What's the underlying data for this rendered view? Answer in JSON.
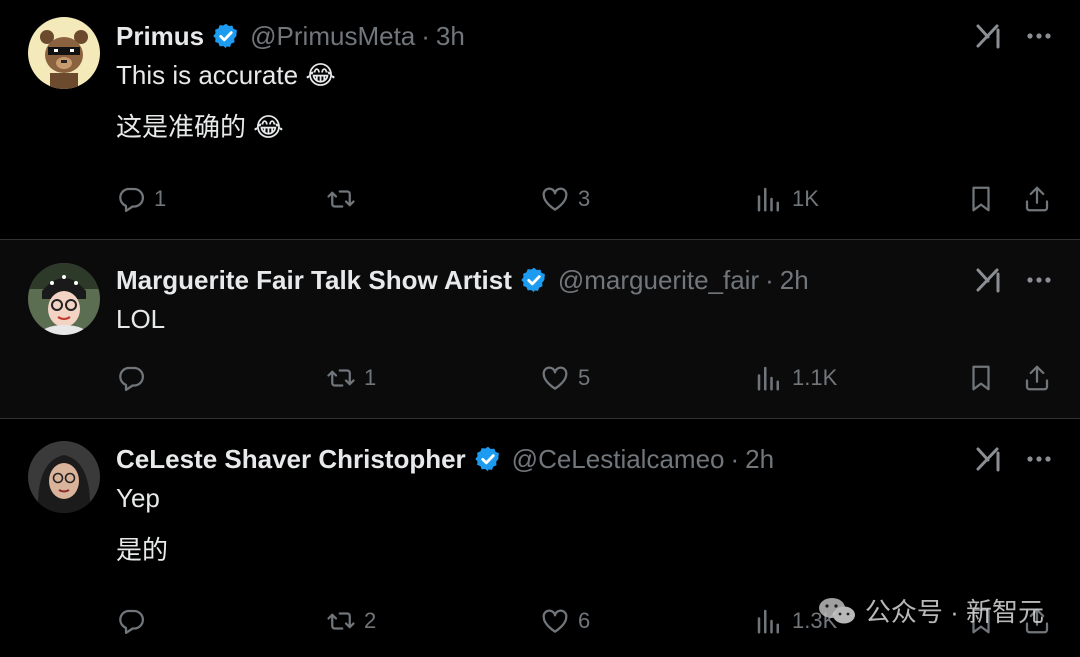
{
  "tweets": [
    {
      "name": "Primus",
      "handle": "@PrimusMeta",
      "separator": "·",
      "time": "3h",
      "lines": [
        "This is accurate",
        "这是准确的"
      ],
      "emoji": "😂",
      "counts": {
        "reply": "1",
        "retweet": "",
        "like": "3",
        "views": "1K"
      }
    },
    {
      "name": "Marguerite Fair Talk Show Artist",
      "handle": "@marguerite_fair",
      "separator": "·",
      "time": "2h",
      "lines": [
        "LOL"
      ],
      "counts": {
        "reply": "",
        "retweet": "1",
        "like": "5",
        "views": "1.1K"
      }
    },
    {
      "name": "CeLeste Shaver Christopher",
      "handle": "@CeLestialcameo",
      "separator": "·",
      "time": "2h",
      "lines": [
        "Yep",
        "是的"
      ],
      "counts": {
        "reply": "",
        "retweet": "2",
        "like": "6",
        "views": "1.3K"
      }
    }
  ],
  "watermark": {
    "text": "公众号 · 新智元"
  },
  "icons": [
    "verified-badge-icon",
    "grok-icon",
    "more-icon",
    "reply-icon",
    "retweet-icon",
    "like-icon",
    "views-icon",
    "bookmark-icon",
    "share-icon",
    "wechat-icon"
  ],
  "colors": {
    "background": "#000000",
    "alt_background": "#0b0b0c",
    "text": "#e7e9ea",
    "muted": "#71767b",
    "verified": "#1d9bf0",
    "separator": "#2f3336"
  }
}
